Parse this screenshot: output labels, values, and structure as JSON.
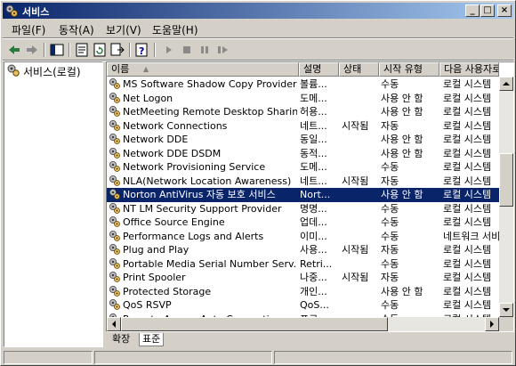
{
  "window": {
    "title": "서비스",
    "min_glyph": "_",
    "max_glyph": "□",
    "close_glyph": "×"
  },
  "menu": [
    "파일(F)",
    "동작(A)",
    "보기(V)",
    "도움말(H)"
  ],
  "tree": {
    "root_label": "서비스(로컬)"
  },
  "columns": [
    "이름",
    "설명",
    "상태",
    "시작 유형",
    "다음 사용자로 로그온"
  ],
  "sort_indicator": "▲",
  "services": [
    {
      "name": "MS Software Shadow Copy Provider",
      "desc": "볼륨...",
      "status": "",
      "startup": "수동",
      "logon": "로컬 시스템"
    },
    {
      "name": "Net Logon",
      "desc": "도메...",
      "status": "",
      "startup": "사용 안 함",
      "logon": "로컬 시스템"
    },
    {
      "name": "NetMeeting Remote Desktop Sharing",
      "desc": "허용...",
      "status": "",
      "startup": "사용 안 함",
      "logon": "로컬 시스템"
    },
    {
      "name": "Network Connections",
      "desc": "네트...",
      "status": "시작됨",
      "startup": "자동",
      "logon": "로컬 시스템"
    },
    {
      "name": "Network DDE",
      "desc": "동일...",
      "status": "",
      "startup": "사용 안 함",
      "logon": "로컬 시스템"
    },
    {
      "name": "Network DDE DSDM",
      "desc": "동적...",
      "status": "",
      "startup": "사용 안 함",
      "logon": "로컬 시스템"
    },
    {
      "name": "Network Provisioning Service",
      "desc": "도메...",
      "status": "",
      "startup": "수동",
      "logon": "로컬 시스템"
    },
    {
      "name": "NLA(Network Location Awareness)",
      "desc": "네트...",
      "status": "시작됨",
      "startup": "자동",
      "logon": "로컬 시스템"
    },
    {
      "name": "Norton AntiVirus 자동 보호 서비스",
      "desc": "Nort...",
      "status": "",
      "startup": "사용 안 함",
      "logon": "로컬 시스템",
      "selected": true
    },
    {
      "name": "NT LM Security Support Provider",
      "desc": "명명...",
      "status": "",
      "startup": "수동",
      "logon": "로컬 시스템"
    },
    {
      "name": "Office Source Engine",
      "desc": "업데...",
      "status": "",
      "startup": "수동",
      "logon": "로컬 시스템"
    },
    {
      "name": "Performance Logs and Alerts",
      "desc": "이미...",
      "status": "",
      "startup": "수동",
      "logon": "네트워크 서비스"
    },
    {
      "name": "Plug and Play",
      "desc": "사용...",
      "status": "시작됨",
      "startup": "자동",
      "logon": "로컬 시스템"
    },
    {
      "name": "Portable Media Serial Number Serv...",
      "desc": "Retri...",
      "status": "",
      "startup": "수동",
      "logon": "로컬 시스템"
    },
    {
      "name": "Print Spooler",
      "desc": "나중...",
      "status": "시작됨",
      "startup": "자동",
      "logon": "로컬 시스템"
    },
    {
      "name": "Protected Storage",
      "desc": "개인...",
      "status": "",
      "startup": "사용 안 함",
      "logon": "로컬 시스템"
    },
    {
      "name": "QoS RSVP",
      "desc": "QoS...",
      "status": "",
      "startup": "수동",
      "logon": "로컬 시스템"
    },
    {
      "name": "Remote Access Auto Connection ...",
      "desc": "프로...",
      "status": "",
      "startup": "수동",
      "logon": "로컬 시스템"
    }
  ],
  "tabs": [
    "확장",
    "표준"
  ],
  "active_tab": "표준"
}
